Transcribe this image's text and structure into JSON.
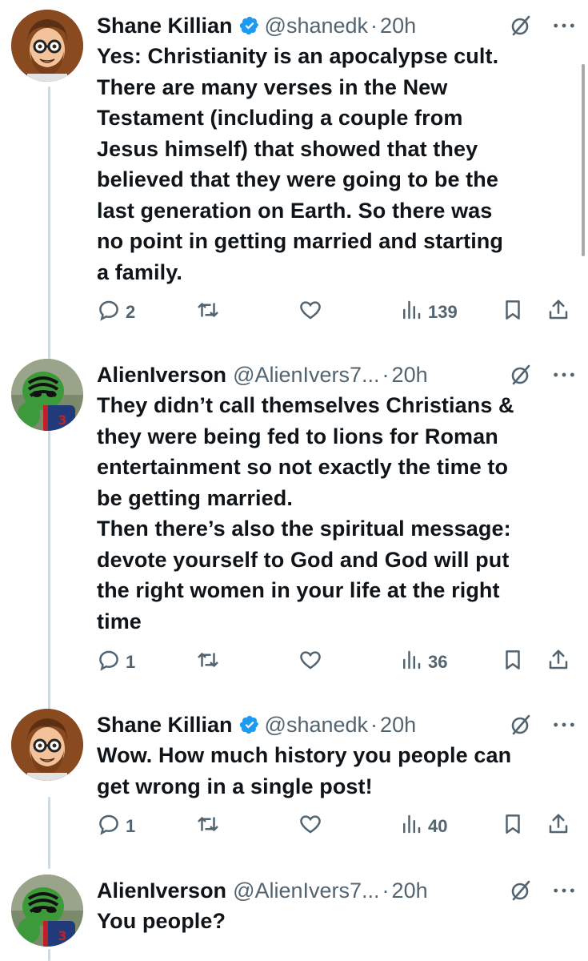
{
  "tweets": [
    {
      "author": "Shane Killian",
      "verified": true,
      "handle": "@shanedk",
      "time": "20h",
      "text_lines": [
        "Yes: Christianity is an apocalypse cult.",
        "There are many verses in the New",
        "Testament (including a couple from",
        "Jesus himself) that showed that they",
        "believed that they were going to be the",
        "last generation on Earth. So there was",
        "no point in getting married and starting",
        "a family."
      ],
      "replies": "2",
      "reposts": "",
      "likes": "",
      "views": "139"
    },
    {
      "author": "AlienIverson",
      "verified": false,
      "handle": "@AlienIvers7...",
      "time": "20h",
      "text_lines": [
        "They didn’t call themselves Christians &",
        "they were being fed to lions for Roman",
        "entertainment so not exactly the time to",
        "be getting married.",
        "Then there’s also the spiritual message:",
        "devote yourself to God and God will put",
        "the right women in your life at the right",
        "time"
      ],
      "replies": "1",
      "reposts": "",
      "likes": "",
      "views": "36"
    },
    {
      "author": "Shane Killian",
      "verified": true,
      "handle": "@shanedk",
      "time": "20h",
      "text_lines": [
        "Wow. How much history you people can",
        "get wrong in a single post!"
      ],
      "replies": "1",
      "reposts": "",
      "likes": "",
      "views": "40"
    },
    {
      "author": "AlienIverson",
      "verified": false,
      "handle": "@AlienIvers7...",
      "time": "20h",
      "text_lines": [
        "You people?"
      ]
    }
  ],
  "separator": "·",
  "icons": {
    "verified": "verified-badge-icon",
    "grok": "grok-icon",
    "more": "more-icon",
    "reply": "reply-icon",
    "repost": "repost-icon",
    "like": "heart-icon",
    "views": "views-icon",
    "bookmark": "bookmark-icon",
    "share": "share-icon"
  },
  "colors": {
    "text": "#0f1419",
    "secondary": "#536471",
    "verified": "#1d9bf0",
    "thread_line": "#cfd9de"
  }
}
